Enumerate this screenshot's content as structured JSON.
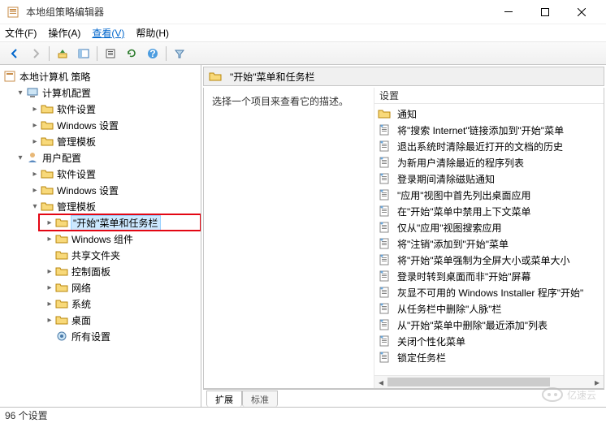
{
  "window": {
    "title": "本地组策略编辑器"
  },
  "menu": {
    "file": "文件(F)",
    "action": "操作(A)",
    "view": "查看(V)",
    "help": "帮助(H)"
  },
  "tree": {
    "root": "本地计算机 策略",
    "computer": "计算机配置",
    "software": "软件设置",
    "windows_settings": "Windows 设置",
    "admin_templates": "管理模板",
    "user": "用户配置",
    "start_taskbar": "\"开始\"菜单和任务栏",
    "windows_components": "Windows 组件",
    "shared_folders": "共享文件夹",
    "control_panel": "控制面板",
    "network": "网络",
    "system": "系统",
    "desktop": "桌面",
    "all_settings": "所有设置"
  },
  "header": {
    "title": "\"开始\"菜单和任务栏"
  },
  "desc": {
    "select_item": "选择一个项目来查看它的描述。"
  },
  "settings_header": "设置",
  "settings": [
    {
      "type": "folder",
      "label": "通知"
    },
    {
      "type": "policy",
      "label": "将\"搜索 Internet\"链接添加到\"开始\"菜单"
    },
    {
      "type": "policy",
      "label": "退出系统时清除最近打开的文档的历史"
    },
    {
      "type": "policy",
      "label": "为新用户清除最近的程序列表"
    },
    {
      "type": "policy",
      "label": "登录期间清除磁贴通知"
    },
    {
      "type": "policy",
      "label": "\"应用\"视图中首先列出桌面应用"
    },
    {
      "type": "policy",
      "label": "在\"开始\"菜单中禁用上下文菜单"
    },
    {
      "type": "policy",
      "label": "仅从\"应用\"视图搜索应用"
    },
    {
      "type": "policy",
      "label": "将\"注销\"添加到\"开始\"菜单"
    },
    {
      "type": "policy",
      "label": "将\"开始\"菜单强制为全屏大小或菜单大小"
    },
    {
      "type": "policy",
      "label": "登录时转到桌面而非\"开始\"屏幕"
    },
    {
      "type": "policy",
      "label": "灰显不可用的 Windows Installer 程序\"开始\""
    },
    {
      "type": "policy",
      "label": "从任务栏中删除\"人脉\"栏"
    },
    {
      "type": "policy",
      "label": "从\"开始\"菜单中删除\"最近添加\"列表"
    },
    {
      "type": "policy",
      "label": "关闭个性化菜单"
    },
    {
      "type": "policy",
      "label": "锁定任务栏"
    }
  ],
  "tabs": {
    "extended": "扩展",
    "standard": "标准"
  },
  "status": {
    "count": "96 个设置"
  },
  "watermark": "亿速云"
}
